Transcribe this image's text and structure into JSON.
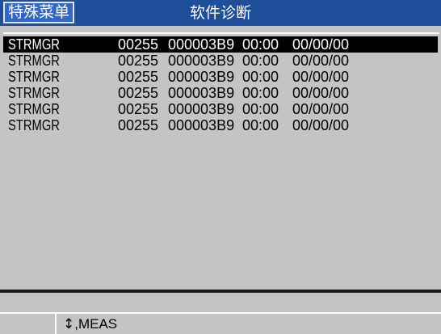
{
  "header": {
    "menu_tab_label": "特殊菜单",
    "title": "软件诊断"
  },
  "diagnostics": {
    "rows": [
      {
        "name": "STRMGR",
        "count": "00255",
        "address": "000003B9",
        "time": "00:00",
        "date": "00/00/00",
        "selected": true
      },
      {
        "name": "STRMGR",
        "count": "00255",
        "address": "000003B9",
        "time": "00:00",
        "date": "00/00/00",
        "selected": false
      },
      {
        "name": "STRMGR",
        "count": "00255",
        "address": "000003B9",
        "time": "00:00",
        "date": "00/00/00",
        "selected": false
      },
      {
        "name": "STRMGR",
        "count": "00255",
        "address": "000003B9",
        "time": "00:00",
        "date": "00/00/00",
        "selected": false
      },
      {
        "name": "STRMGR",
        "count": "00255",
        "address": "000003B9",
        "time": "00:00",
        "date": "00/00/00",
        "selected": false
      },
      {
        "name": "STRMGR",
        "count": "00255",
        "address": "000003B9",
        "time": "00:00",
        "date": "00/00/00",
        "selected": false
      }
    ]
  },
  "footer": {
    "arrow_icon": "updown-arrow-icon",
    "arrow_glyph": "↕",
    "hint": ",MEAS"
  },
  "colors": {
    "header_bg": "#1f4f9a",
    "tab_bg": "#3168c8",
    "panel_bg": "#c4c4c4",
    "selected_bg": "#000000"
  }
}
